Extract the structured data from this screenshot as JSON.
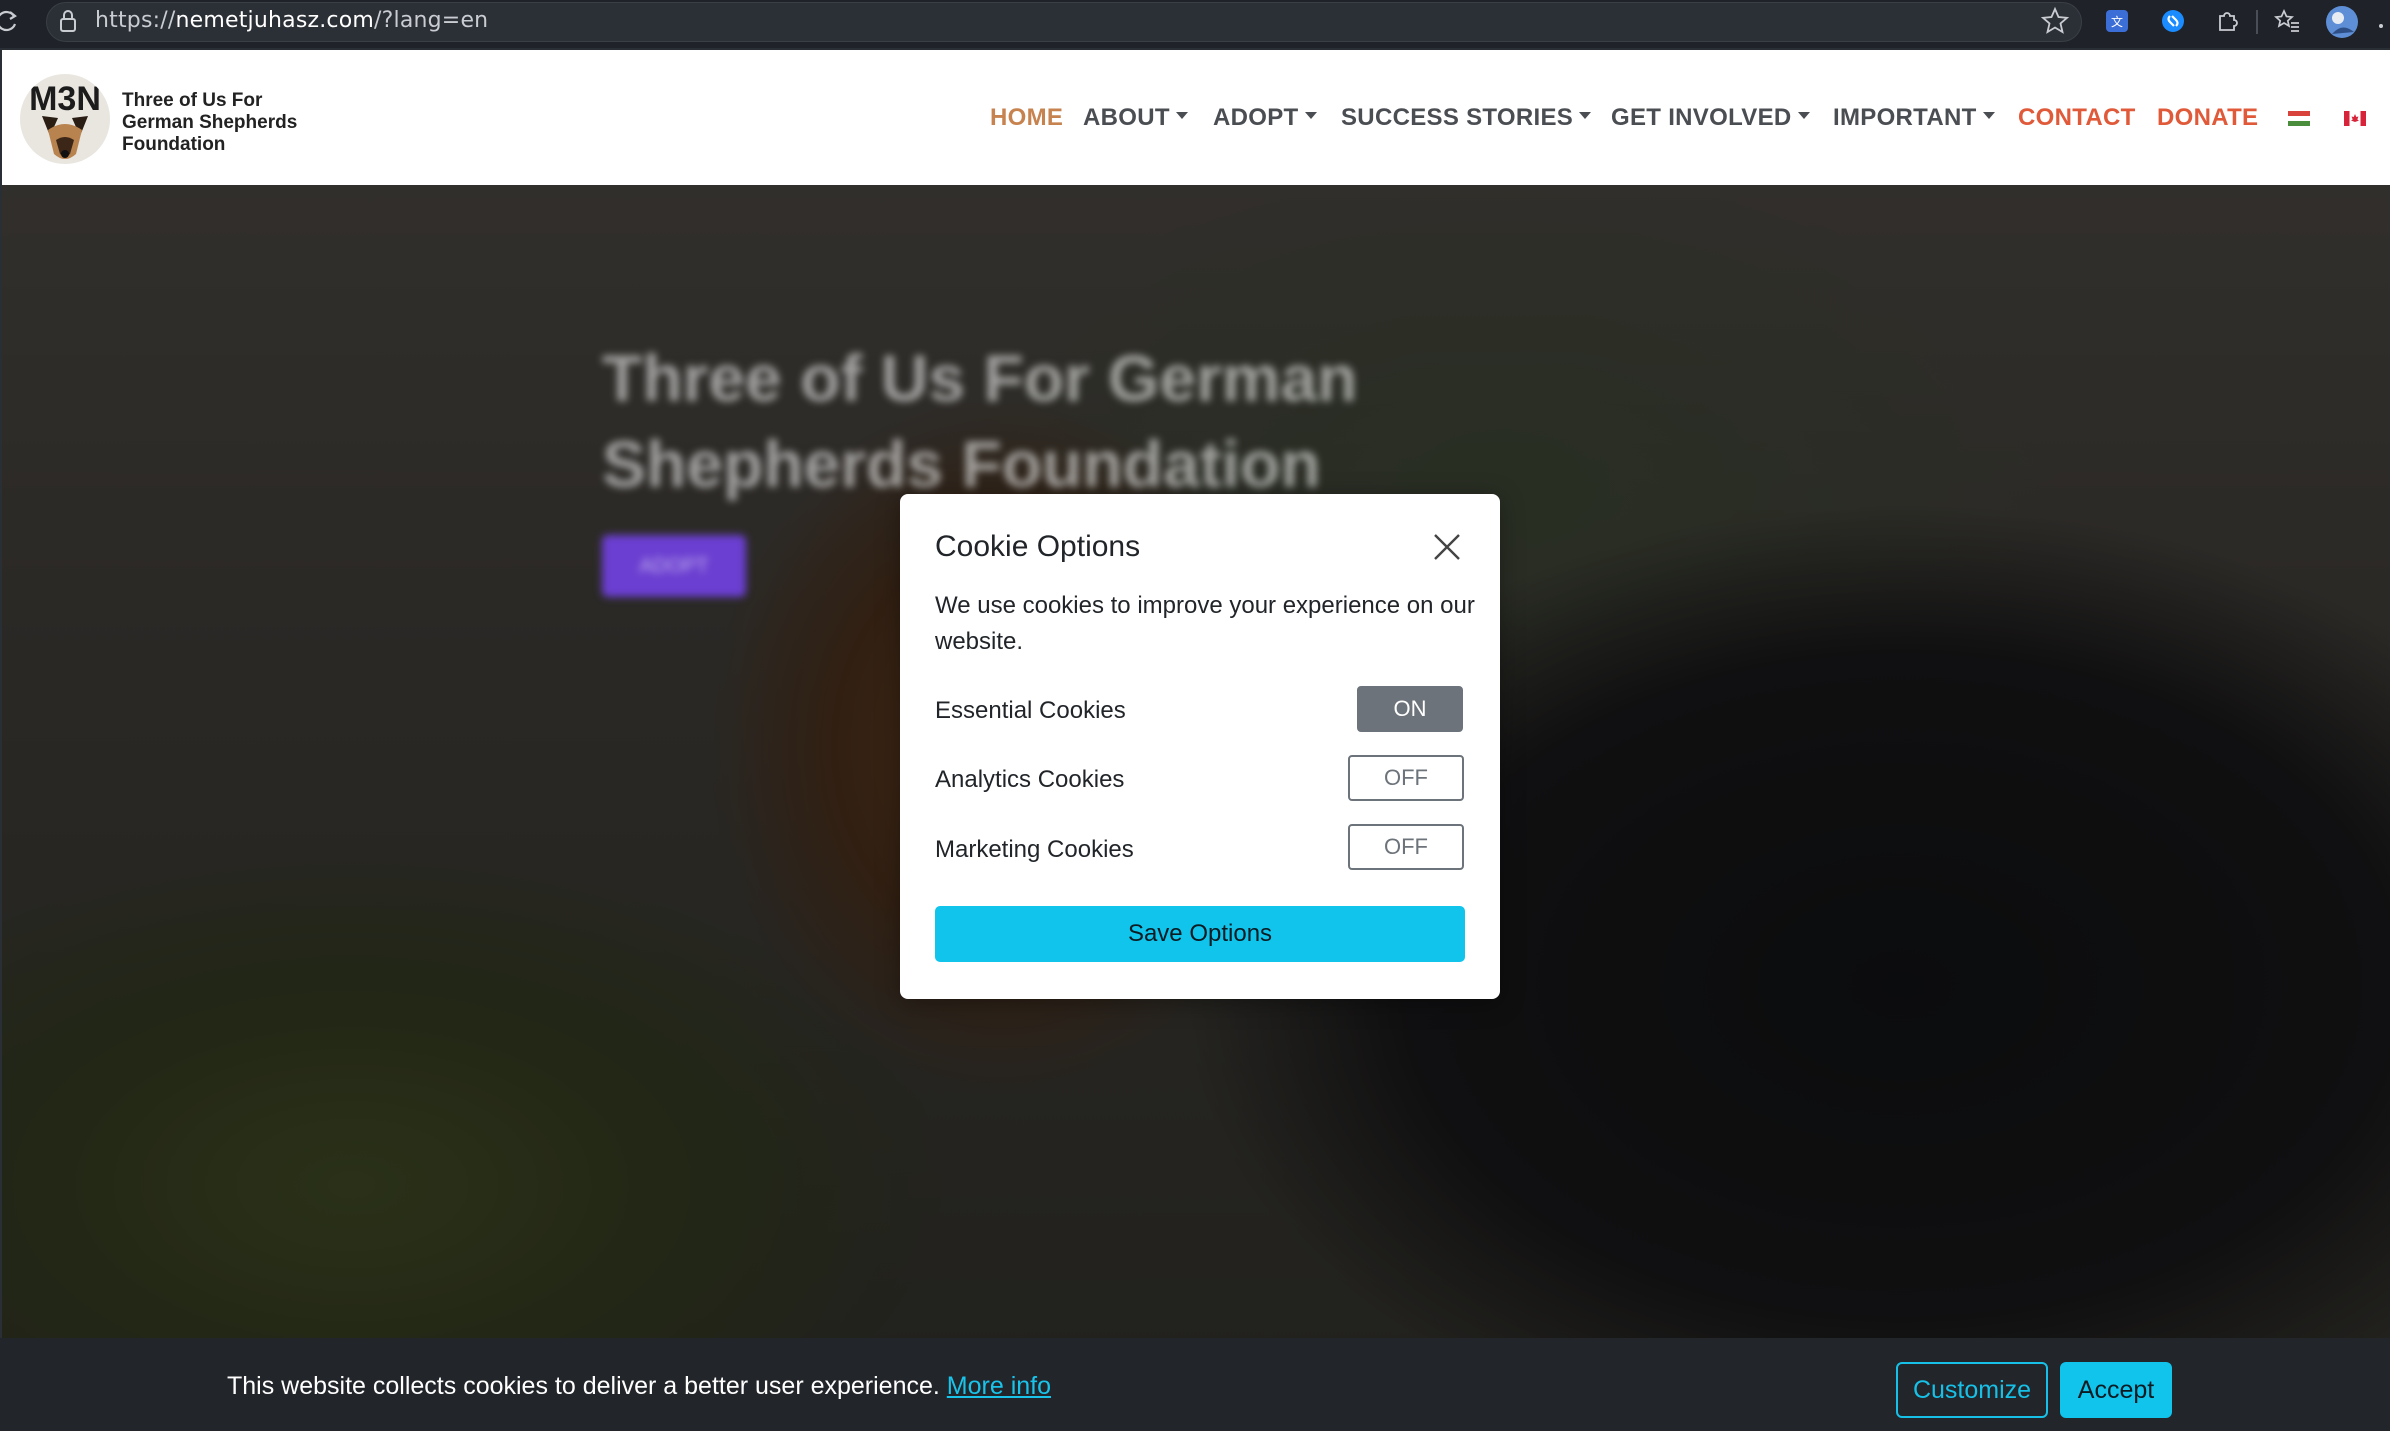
{
  "browser": {
    "url_scheme": "https://",
    "url_host": "nemetjuhasz.com",
    "url_path": "/?lang=en"
  },
  "site": {
    "logo_mark": "M3N",
    "logo_lines": [
      "Three of Us For",
      "German Shepherds",
      "Foundation"
    ],
    "nav": {
      "home": "HOME",
      "about": "ABOUT",
      "adopt": "ADOPT",
      "success_stories": "SUCCESS STORIES",
      "get_involved": "GET INVOLVED",
      "important": "IMPORTANT",
      "contact": "CONTACT",
      "donate": "DONATE"
    },
    "flags": [
      "hungary-flag-icon",
      "canada-flag-icon"
    ]
  },
  "hero": {
    "title": "Three of Us For German Shepherds Foundation",
    "button_label": "ADOPT"
  },
  "modal": {
    "title": "Cookie Options",
    "description": "We use cookies to improve your experience on our website.",
    "options": [
      {
        "label": "Essential Cookies",
        "state": "ON"
      },
      {
        "label": "Analytics Cookies",
        "state": "OFF"
      },
      {
        "label": "Marketing Cookies",
        "state": "OFF"
      }
    ],
    "save_label": "Save Options"
  },
  "cookie_bar": {
    "text": "This website collects cookies to deliver a better user experience.",
    "more_info": "More info",
    "customize_label": "Customize",
    "accept_label": "Accept"
  },
  "colors": {
    "accent_cyan": "#10c4ec",
    "nav_home": "#c7834f",
    "nav_red": "#e05a3a"
  }
}
